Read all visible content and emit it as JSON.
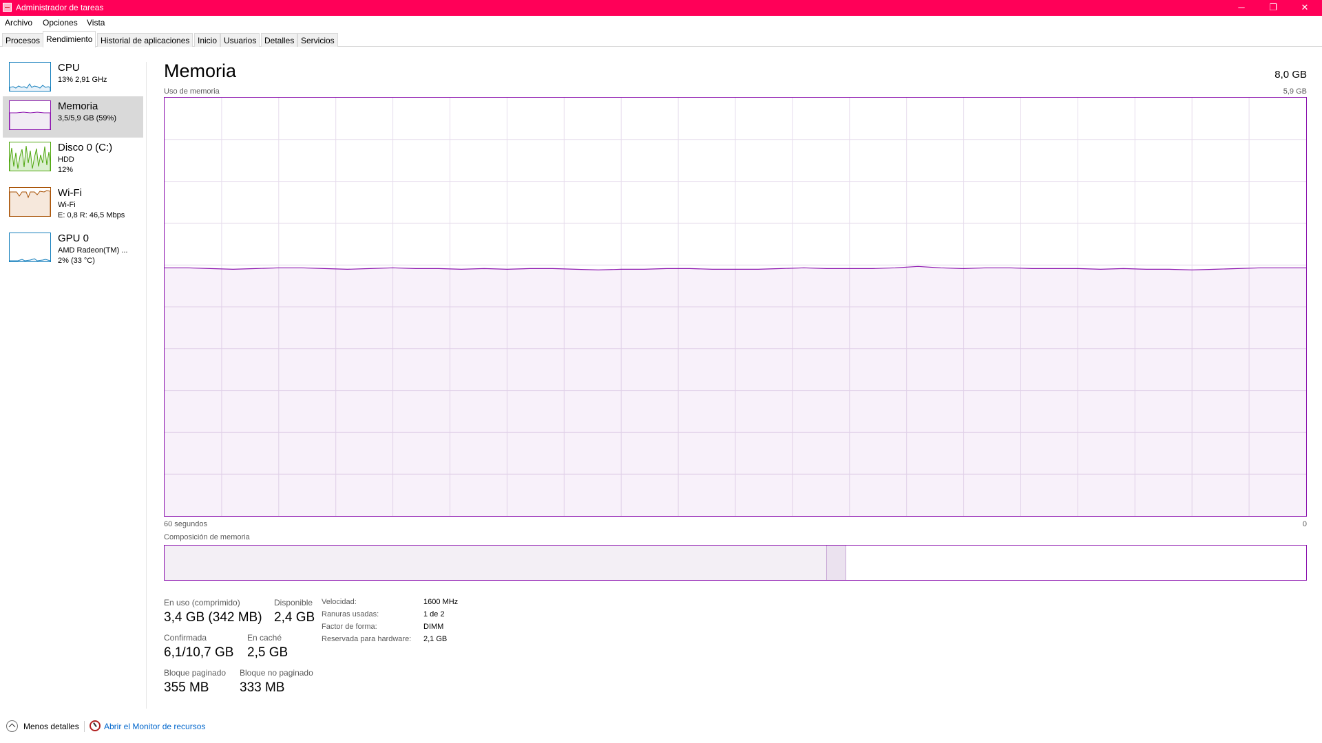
{
  "window": {
    "title": "Administrador de tareas",
    "accent_color": "#ff0058",
    "controls": {
      "minimize_icon": "─",
      "restore_icon": "❐",
      "close_icon": "✕"
    }
  },
  "menu": [
    "Archivo",
    "Opciones",
    "Vista"
  ],
  "tabs": [
    "Procesos",
    "Rendimiento",
    "Historial de aplicaciones",
    "Inicio",
    "Usuarios",
    "Detalles",
    "Servicios"
  ],
  "active_tab": "Rendimiento",
  "sidebar": [
    {
      "title": "CPU",
      "lines": [
        "13%  2,91 GHz"
      ],
      "color": "#117dbb"
    },
    {
      "title": "Memoria",
      "lines": [
        "3,5/5,9 GB (59%)"
      ],
      "color": "#8b12ae",
      "selected": true
    },
    {
      "title": "Disco 0 (C:)",
      "lines": [
        "HDD",
        "12%"
      ],
      "color": "#4da60c"
    },
    {
      "title": "Wi-Fi",
      "lines": [
        "Wi-Fi",
        "E: 0,8  R: 46,5 Mbps"
      ],
      "color": "#a74f01"
    },
    {
      "title": "GPU 0",
      "lines": [
        "AMD Radeon(TM) ...",
        "2%  (33 °C)"
      ],
      "color": "#117dbb"
    }
  ],
  "main": {
    "heading": "Memoria",
    "total": "8,0 GB",
    "usage_label": "Uso de memoria",
    "usage_max": "5,9 GB",
    "time_left": "60 segundos",
    "time_right": "0",
    "composition_label": "Composición de memoria",
    "line_color": "#8b12ae"
  },
  "chart_data": {
    "type": "area",
    "title": "Uso de memoria",
    "unit": "GB",
    "ylim": [
      0,
      5.9
    ],
    "xlim": [
      60,
      0
    ],
    "grid": true,
    "series": [
      {
        "values": [
          3.5,
          3.5,
          3.49,
          3.48,
          3.49,
          3.5,
          3.5,
          3.49,
          3.48,
          3.49,
          3.5,
          3.49,
          3.49,
          3.48,
          3.49,
          3.48,
          3.49,
          3.49,
          3.48,
          3.47,
          3.48,
          3.48,
          3.49,
          3.49,
          3.48,
          3.48,
          3.48,
          3.49,
          3.5,
          3.49,
          3.49,
          3.49,
          3.5,
          3.52,
          3.5,
          3.49,
          3.5,
          3.5,
          3.49,
          3.49,
          3.49,
          3.48,
          3.49,
          3.48,
          3.48,
          3.47,
          3.48,
          3.49,
          3.5,
          3.5,
          3.5
        ]
      }
    ]
  },
  "composition": {
    "in_use_fraction": 0.58,
    "modified_fraction": 0.017
  },
  "stats": [
    {
      "label": "En uso (comprimido)",
      "value": "3,4 GB (342 MB)"
    },
    {
      "label": "Disponible",
      "value": "2,4 GB"
    },
    {
      "label": "Confirmada",
      "value": "6,1/10,7 GB"
    },
    {
      "label": "En caché",
      "value": "2,5 GB"
    },
    {
      "label": "Bloque paginado",
      "value": "355 MB"
    },
    {
      "label": "Bloque no paginado",
      "value": "333 MB"
    }
  ],
  "details": [
    {
      "label": "Velocidad:",
      "value": "1600 MHz"
    },
    {
      "label": "Ranuras usadas:",
      "value": "1 de 2"
    },
    {
      "label": "Factor de forma:",
      "value": "DIMM"
    },
    {
      "label": "Reservada para hardware:",
      "value": "2,1 GB"
    }
  ],
  "footer": {
    "less_details": "Menos detalles",
    "resource_monitor": "Abrir el Monitor de recursos"
  }
}
